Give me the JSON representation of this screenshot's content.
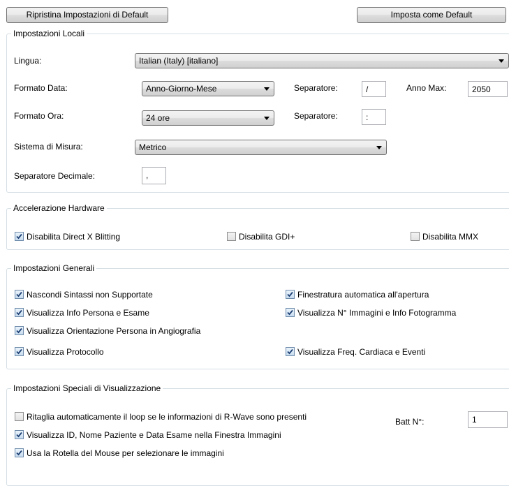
{
  "buttons": {
    "reset": "Ripristina Impostazioni di Default",
    "set_default": "Imposta come Default"
  },
  "local": {
    "title": "Impostazioni Locali",
    "language_label": "Lingua:",
    "language_value": "Italian (Italy)    [italiano]",
    "date_format_label": "Formato Data:",
    "date_format_value": "Anno-Giorno-Mese",
    "date_separator_label": "Separatore:",
    "date_separator_value": "/",
    "max_year_label": "Anno Max:",
    "max_year_value": "2050",
    "time_format_label": "Formato Ora:",
    "time_format_value": "24 ore",
    "time_separator_label": "Separatore:",
    "time_separator_value": ":",
    "measure_label": "Sistema di Misura:",
    "measure_value": "Metrico",
    "decimal_label": "Separatore Decimale:",
    "decimal_value": ","
  },
  "hardware": {
    "title": "Accelerazione Hardware",
    "options": [
      {
        "label": "Disabilita Direct X Blitting",
        "checked": true
      },
      {
        "label": "Disabilita GDI+",
        "checked": false
      },
      {
        "label": "Disabilita MMX",
        "checked": false
      }
    ]
  },
  "general": {
    "title": "Impostazioni Generali",
    "options": [
      {
        "label": "Nascondi Sintassi non Supportate",
        "checked": true
      },
      {
        "label": "Finestratura automatica all'apertura",
        "checked": true
      },
      {
        "label": "Visualizza Info Persona e Esame",
        "checked": true
      },
      {
        "label": "Visualizza N° Immagini e Info Fotogramma",
        "checked": true
      },
      {
        "label": "Visualizza Orientazione Persona in Angiografia",
        "checked": true
      },
      {
        "label": "Visualizza Protocollo",
        "checked": true
      },
      {
        "label": "Visualizza Freq. Cardiaca e Eventi",
        "checked": true
      }
    ]
  },
  "special": {
    "title": "Impostazioni Speciali di Visualizzazione",
    "options": [
      {
        "label": "Ritaglia automaticamente il loop se le informazioni di R-Wave sono presenti",
        "checked": false
      },
      {
        "label": "Visualizza ID, Nome Paziente e Data Esame nella Finestra Immagini",
        "checked": true
      },
      {
        "label": "Usa la Rotella del Mouse per selezionare le immagini",
        "checked": true
      }
    ],
    "beat_label": "Batt N°:",
    "beat_value": "1"
  }
}
